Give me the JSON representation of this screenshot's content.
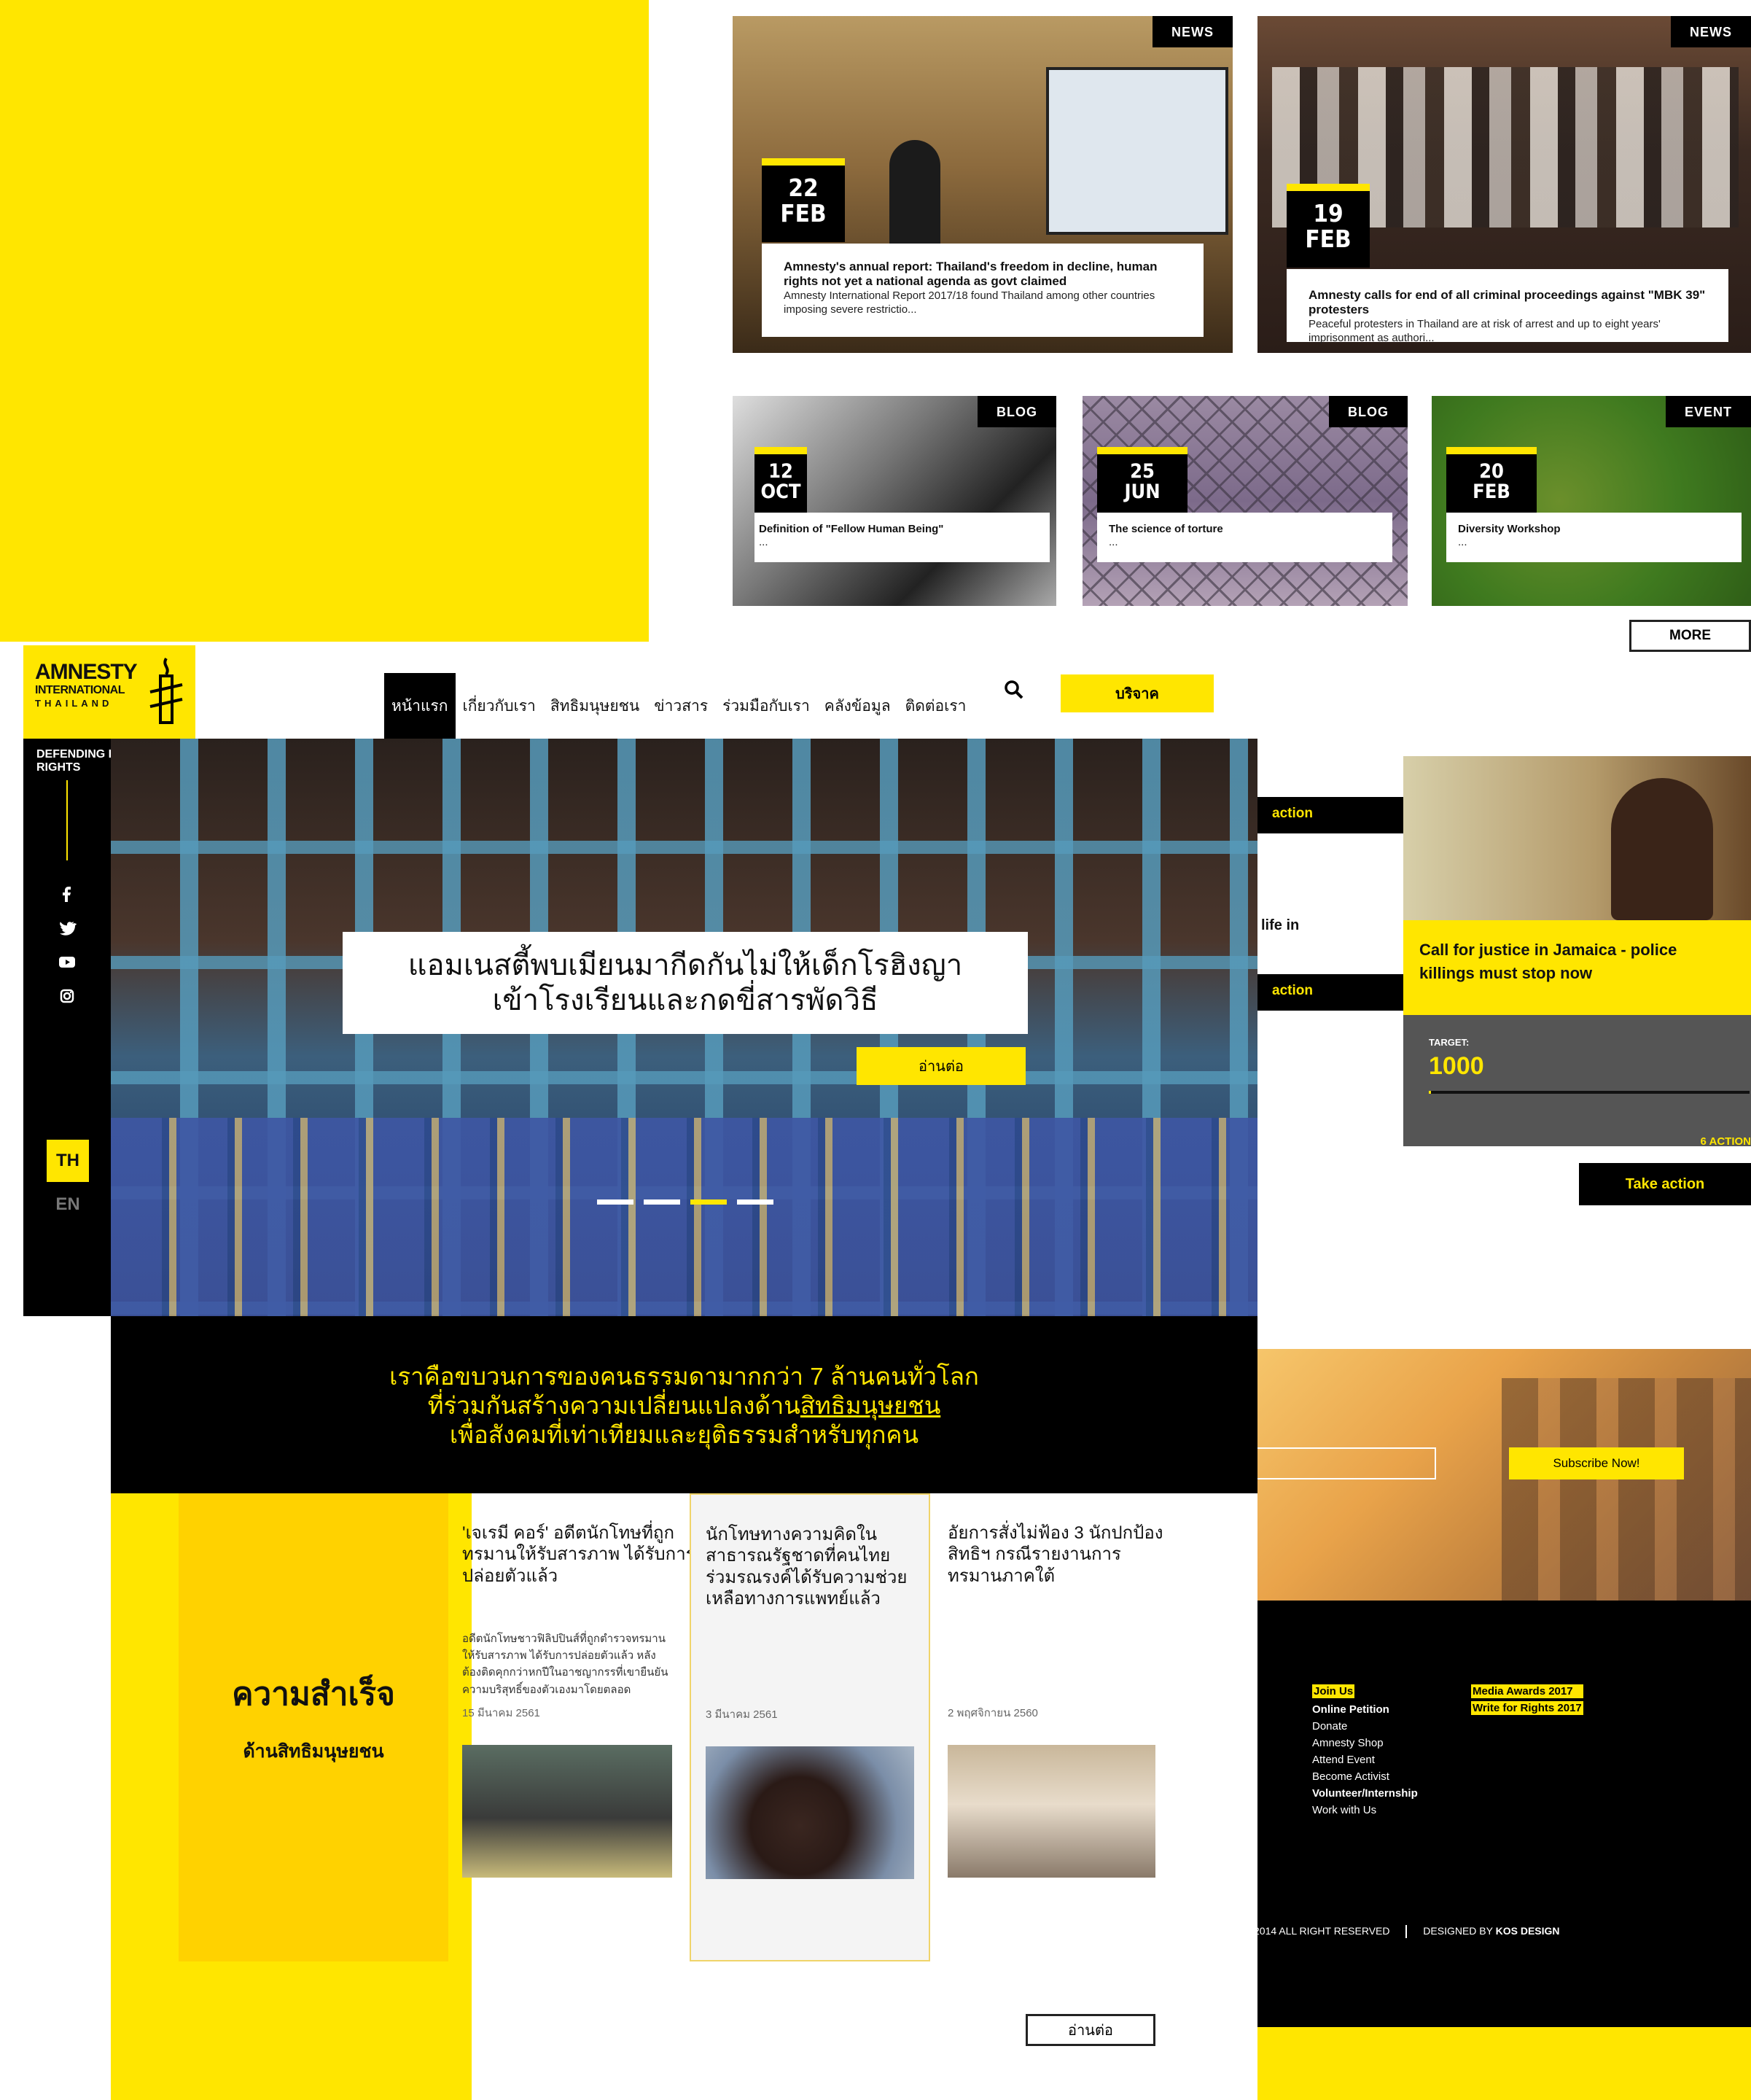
{
  "top_news": [
    {
      "tag": "NEWS",
      "day": "22",
      "month": "FEB",
      "title": "Amnesty's annual report: Thailand's freedom in decline, human rights not yet a national agenda as govt claimed",
      "text": "Amnesty International Report 2017/18 found Thailand among other countries imposing severe restrictio..."
    },
    {
      "tag": "NEWS",
      "day": "19",
      "month": "FEB",
      "title": "Amnesty calls for end of all criminal proceedings against \"MBK 39\" protesters",
      "text": "Peaceful protesters in Thailand are at risk of arrest and up to eight years' imprisonment as authori..."
    }
  ],
  "small_cards": [
    {
      "tag": "BLOG",
      "day": "12",
      "month": "OCT",
      "title": "Definition of \"Fellow Human Being\"",
      "text": "..."
    },
    {
      "tag": "BLOG",
      "day": "25",
      "month": "JUN",
      "title": "The science of torture",
      "text": "..."
    },
    {
      "tag": "EVENT",
      "day": "20",
      "month": "FEB",
      "title": "Diversity Workshop",
      "text": "..."
    }
  ],
  "more_label": "MORE",
  "action_fragments": {
    "btn1": "action",
    "text": "life in",
    "btn2": "action"
  },
  "campaign": {
    "title": "Call for justice in Jamaica - police killings must stop now",
    "target_label": "TARGET:",
    "target_value": "1000",
    "actions": "6 ACTION",
    "progress": 0.006,
    "button": "Take action"
  },
  "subscribe": {
    "button": "Subscribe Now!"
  },
  "footer": {
    "col1": [
      "Join Us",
      "Online Petition",
      "Donate",
      "Amnesty Shop",
      "Attend Event",
      "Become Activist",
      "Volunteer/Internship",
      "Work with Us"
    ],
    "col2": [
      "Media Awards 2017",
      "Write for Rights 2017"
    ],
    "copyright": "2014 ALL RIGHT RESERVED",
    "designed_prefix": "DESIGNED BY ",
    "designed_by": "KOS DESIGN"
  },
  "logo": {
    "line1": "AMNESTY",
    "line2": "INTERNATIONAL",
    "line3": "THAILAND",
    "tagline": "DEFENDING HUMAN RIGHTS"
  },
  "nav": {
    "items": [
      "หน้าแรก",
      "เกี่ยวกับเรา",
      "สิทธิมนุษยชน",
      "ข่าวสาร",
      "ร่วมมือกับเรา",
      "คลังข้อมูล",
      "ติดต่อเรา"
    ],
    "donate": "บริจาค"
  },
  "languages": [
    "TH",
    "EN"
  ],
  "hero": {
    "headline_1": "แอมเนสตี้พบเมียนมากีดกันไม่ให้เด็กโรฮิงญา",
    "headline_2": "เข้าโรงเรียนและกดขี่สารพัดวิธี",
    "button": "อ่านต่อ",
    "active_slide": 3
  },
  "mission": {
    "line1": "เราคือขบวนการของคนธรรมดามากกว่า 7 ล้านคนทั่วโลก",
    "line2_prefix": "ที่ร่วมกันสร้างความเปลี่ยนแปลงด้าน",
    "line2_link": "สิทธิมนุษยชน",
    "line3": "เพื่อสังคมที่เท่าเทียมและยุติธรรมสำหรับทุกคน"
  },
  "success": {
    "title": "ความสำเร็จ",
    "subtitle": "ด้านสิทธิมนุษยชน"
  },
  "stories": [
    {
      "title": "'เจเรมี คอร์' อดีตนักโทษที่ถูกทรมานให้รับสารภาพ ได้รับการปล่อยตัวแล้ว",
      "text": "อดีตนักโทษชาวฟิลิปปินส์ที่ถูกตำรวจทรมานให้รับสารภาพ ได้รับการปล่อยตัวแล้ว หลังต้องติดคุกกว่าหกปีในอาชญากรรที่เขายืนยันความบริสุทธิ์ของตัวเองมาโดยตลอด",
      "date": "15 มีนาคม 2561"
    },
    {
      "title": "นักโทษทางความคิดในสาธารณรัฐชาดที่คนไทยร่วมรณรงค์ได้รับความช่วยเหลือทางการแพทย์แล้ว",
      "text": "",
      "date": "3 มีนาคม 2561"
    },
    {
      "title": "อัยการสั่งไม่ฟ้อง 3 นักปกป้องสิทธิฯ กรณีรายงานการทรมานภาคใต้",
      "text": "",
      "date": "2 พฤศจิกายน 2560"
    }
  ],
  "read_more": "อ่านต่อ"
}
